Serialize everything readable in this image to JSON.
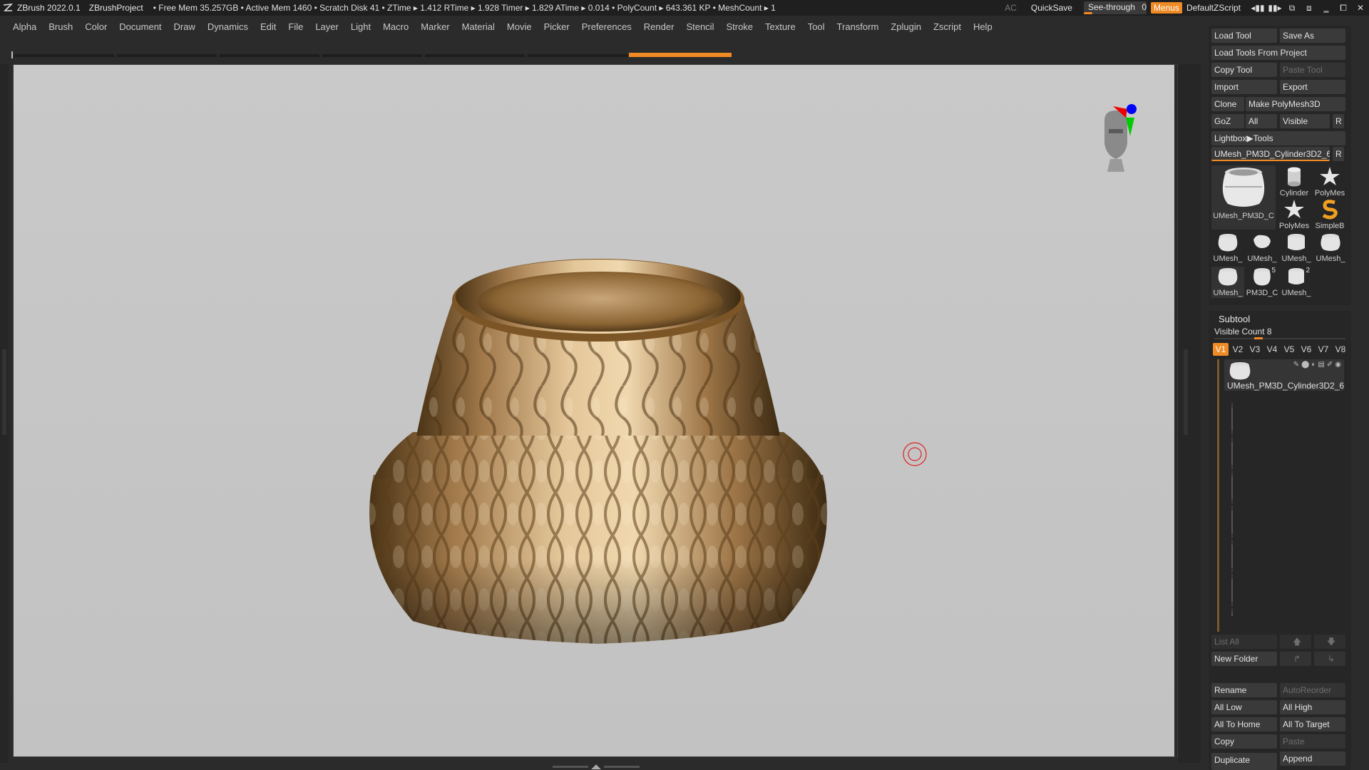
{
  "titlebar": {
    "app": "ZBrush 2022.0.1",
    "project": "ZBrushProject",
    "stats": "• Free Mem 35.257GB • Active Mem 1460 • Scratch Disk 41 •  ZTime ▸ 1.412 RTime ▸ 1.928 Timer ▸ 1.829 ATime ▸ 0.014 • PolyCount ▸ 643.361 KP  • MeshCount ▸ 1",
    "ac": "AC",
    "quicksave": "QuickSave",
    "seethrough_label": "See-through",
    "seethrough_value": "0",
    "menus": "Menus",
    "script": "DefaultZScript"
  },
  "menubar": [
    "Alpha",
    "Brush",
    "Color",
    "Document",
    "Draw",
    "Dynamics",
    "Edit",
    "File",
    "Layer",
    "Light",
    "Macro",
    "Marker",
    "Material",
    "Movie",
    "Picker",
    "Preferences",
    "Render",
    "Stencil",
    "Stroke",
    "Texture",
    "Tool",
    "Transform",
    "Zplugin",
    "Zscript",
    "Help"
  ],
  "tool": {
    "load_tool": "Load Tool",
    "save_as": "Save As",
    "load_from_project": "Load Tools From Project",
    "copy_tool": "Copy Tool",
    "paste_tool": "Paste Tool",
    "import": "Import",
    "export": "Export",
    "clone": "Clone",
    "make_polymesh": "Make PolyMesh3D",
    "goz": "GoZ",
    "all": "All",
    "visible": "Visible",
    "r": "R",
    "lightbox_tools": "Lightbox▶Tools",
    "current_tool": "UMesh_PM3D_Cylinder3D2_6",
    "thumbs_main": "UMesh_PM3D_C",
    "thumbs_small": [
      {
        "label": "Cylinder",
        "icon": "cylinder-icon"
      },
      {
        "label": "PolyMes",
        "icon": "star-icon"
      },
      {
        "label": "PolyMes",
        "icon": "star-icon"
      },
      {
        "label": "SimpleB",
        "icon": "simplebrush-icon"
      }
    ],
    "thumbs_row3": [
      "UMesh_",
      "UMesh_",
      "UMesh_",
      "UMesh_"
    ],
    "thumbs_row4": [
      "UMesh_",
      "PM3D_C",
      "UMesh_"
    ],
    "badges": {
      "b5": "5",
      "b2": "2"
    }
  },
  "subtool": {
    "title": "Subtool",
    "visible_count": "Visible Count 8",
    "vtabs": [
      "V1",
      "V2",
      "V3",
      "V4",
      "V5",
      "V6",
      "V7",
      "V8"
    ],
    "item_name": "UMesh_PM3D_Cylinder3D2_6",
    "list_all": "List All",
    "new_folder": "New Folder",
    "rename": "Rename",
    "autoreorder": "AutoReorder",
    "all_low": "All Low",
    "all_high": "All High",
    "all_to_home": "All To Home",
    "all_to_target": "All To Target",
    "copy": "Copy",
    "paste": "Paste",
    "append": "Append",
    "duplicate": "Duplicate"
  },
  "colors": {
    "accent": "#f08a24",
    "viewport": "#c5c5c5",
    "panel": "#262626"
  }
}
